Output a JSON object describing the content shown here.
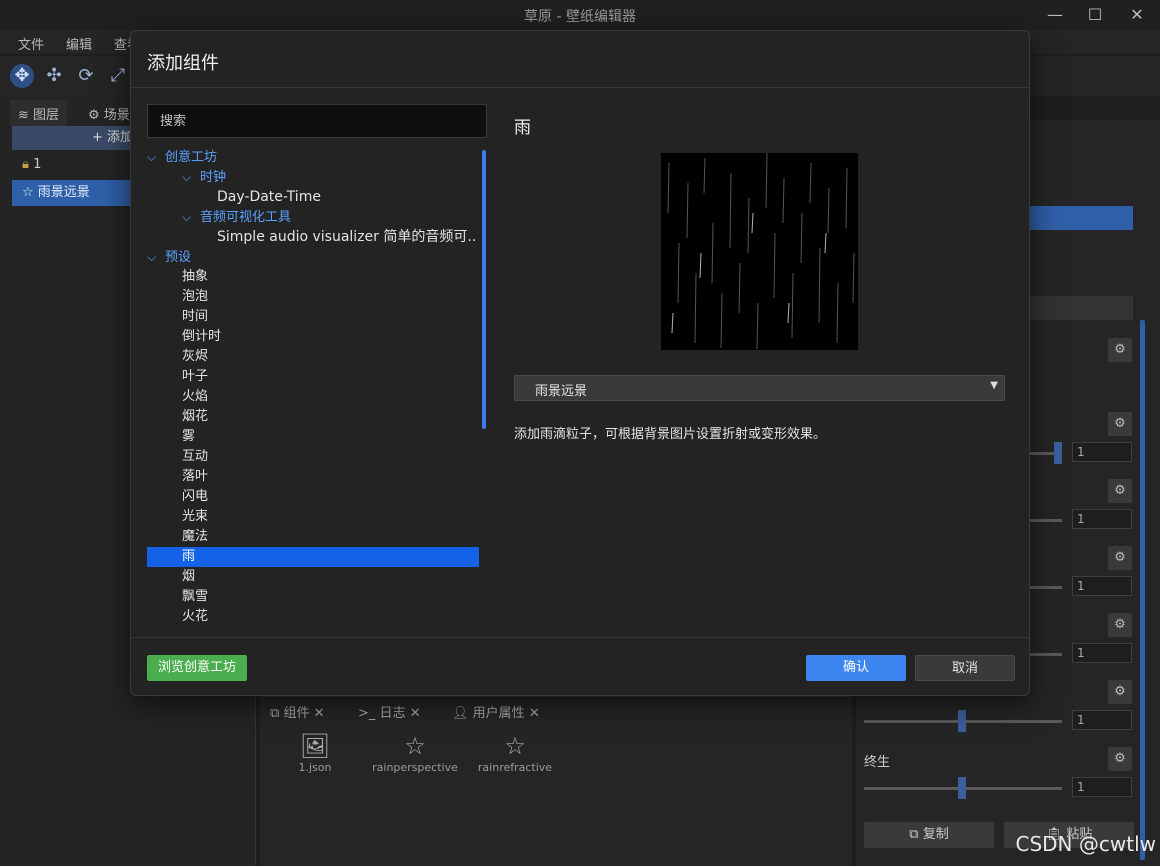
{
  "window": {
    "title": "草原 - 壁纸编辑器",
    "menu": [
      "文件",
      "编辑",
      "查看"
    ]
  },
  "left_panel": {
    "tabs": [
      "图层",
      "场景"
    ],
    "add_label": "+ 添加",
    "layers": [
      "1",
      "雨景远景"
    ]
  },
  "right_panel": {
    "label_lifetime": "终生",
    "values": [
      "1",
      "1",
      "1",
      "1",
      "1",
      "1"
    ],
    "copy_label": "复制",
    "paste_label": "粘贴"
  },
  "bottom_panel": {
    "tabs": [
      "组件",
      "日志",
      "用户属性"
    ],
    "items": [
      "1.json",
      "rainperspective",
      "rainrefractive"
    ]
  },
  "dialog": {
    "title": "添加组件",
    "search_placeholder": "搜索",
    "tree": {
      "workshop": "创意工坊",
      "clock": "时钟",
      "clock_item": "Day-Date-Time",
      "audio": "音频可视化工具",
      "audio_item": "Simple audio visualizer 简单的音频可...",
      "presets": "预设",
      "preset_items": [
        "抽象",
        "泡泡",
        "时间",
        "倒计时",
        "灰烬",
        "叶子",
        "火焰",
        "烟花",
        "雾",
        "互动",
        "落叶",
        "闪电",
        "光束",
        "魔法",
        "雨",
        "烟",
        "飘雪",
        "火花"
      ]
    },
    "detail": {
      "title": "雨",
      "variant": "雨景远景",
      "description": "添加雨滴粒子，可根据背景图片设置折射或变形效果。"
    },
    "browse_label": "浏览创意工坊",
    "ok_label": "确认",
    "cancel_label": "取消"
  },
  "watermark": "CSDN @cwtlw"
}
